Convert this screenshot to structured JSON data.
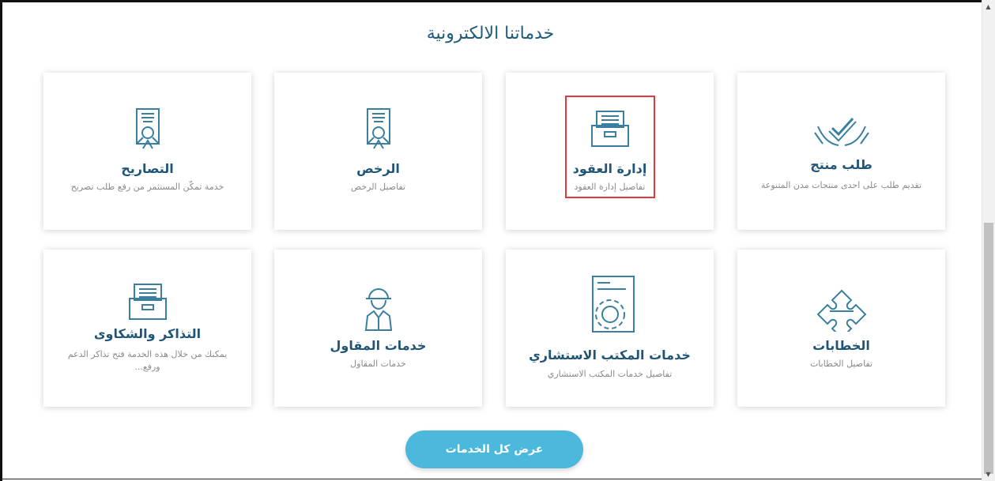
{
  "section_title": "خدماتنا الالكترونية",
  "cards": [
    {
      "name": "طلب منتج",
      "desc": "تقديم طلب على احدى منتجات مدن المتنوعة",
      "icon": "handshake-check-icon"
    },
    {
      "name": "إدارة العقود",
      "desc": "تفاصيل إدارة العقود",
      "icon": "file-drawer-icon"
    },
    {
      "name": "الرخص",
      "desc": "تفاصيل الرخص",
      "icon": "certificate-icon"
    },
    {
      "name": "التصاريح",
      "desc": "خدمة تمكّن المستثمر من رفع طلب تصريح",
      "icon": "certificate-icon"
    },
    {
      "name": "الخطابات",
      "desc": "تفاصيل الخطابات",
      "icon": "puzzle-icon"
    },
    {
      "name": "خدمات المكتب الاستشاري",
      "desc": "تفاصيل خدمات المكتب الاستشاري",
      "icon": "document-gear-icon"
    },
    {
      "name": "خدمات المقاول",
      "desc": "خدمات المقاول",
      "icon": "contractor-icon"
    },
    {
      "name": "التذاكر والشكاوى",
      "desc": "يمكنك من خلال هذه الخدمة فتح تذاكر الدعم ورفع...",
      "icon": "file-drawer-icon"
    }
  ],
  "view_all_label": "عرض كل الخدمات",
  "colors": {
    "accent": "#4bb8dc",
    "title": "#1f5c7a",
    "icon": "#3a7fa0",
    "highlight": "#e0393b"
  }
}
